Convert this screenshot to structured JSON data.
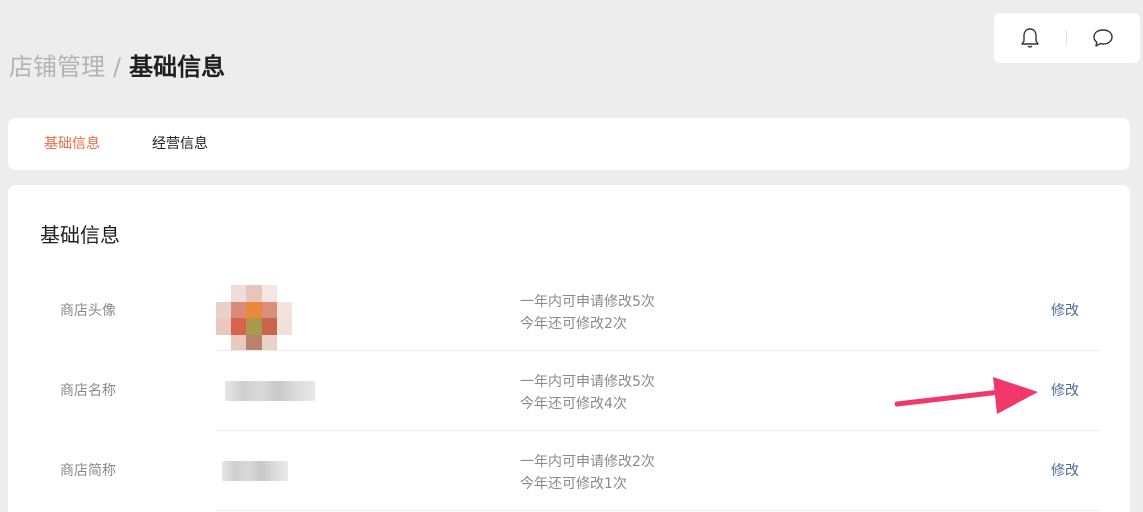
{
  "breadcrumb": {
    "parent": "店铺管理",
    "separator": "/",
    "current": "基础信息"
  },
  "top_actions": {
    "icons": [
      "bell-icon",
      "chat-bubble-icon"
    ]
  },
  "tabs": [
    {
      "label": "基础信息",
      "active": true
    },
    {
      "label": "经营信息",
      "active": false
    }
  ],
  "section": {
    "title": "基础信息",
    "rows": [
      {
        "label": "商店头像",
        "note_line1": "一年内可申请修改5次",
        "note_line2": "今年还可修改2次",
        "action": "修改"
      },
      {
        "label": "商店名称",
        "note_line1": "一年内可申请修改5次",
        "note_line2": "今年还可修改4次",
        "action": "修改"
      },
      {
        "label": "商店简称",
        "note_line1": "一年内可申请修改2次",
        "note_line2": "今年还可修改1次",
        "action": "修改"
      }
    ]
  },
  "colors": {
    "accent": "#ef6b43",
    "link": "#4a6a9a",
    "annotation_arrow": "#f0386b",
    "avatar_pixels": [
      "#ffffff",
      "#f1ddd8",
      "#e8c4bb",
      "#f4e6e2",
      "#ffffff",
      "#ead0c8",
      "#d98a7a",
      "#e88a3a",
      "#d9907a",
      "#f3e2dd",
      "#e9c9bf",
      "#d8624c",
      "#a89a4a",
      "#c8654a",
      "#f2e0db",
      "#ffffff",
      "#e8c9bf",
      "#b8826c",
      "#ead2ca",
      "#ffffff"
    ]
  }
}
